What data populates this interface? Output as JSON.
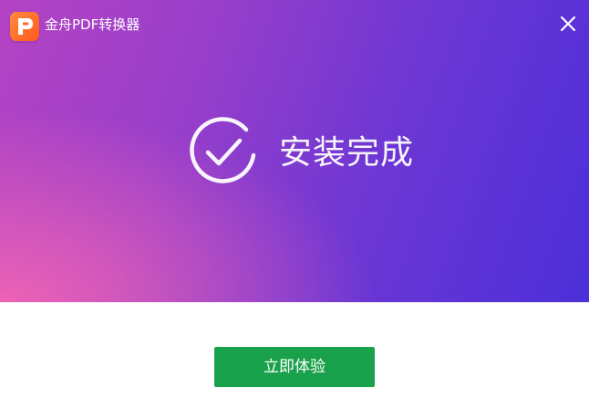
{
  "window": {
    "title": "金舟PDF转换器"
  },
  "titlebar": {
    "logo_icon": "app-logo-icon",
    "close_icon": "close-icon"
  },
  "status": {
    "icon": "check-circle-icon",
    "text": "安装完成"
  },
  "actions": {
    "primary_label": "立即体验"
  },
  "colors": {
    "banner_start": "#f064b4",
    "banner_mid": "#9a3fca",
    "banner_end": "#4c2fd9",
    "button": "#19a24b",
    "logo": "#ff6a2a"
  }
}
